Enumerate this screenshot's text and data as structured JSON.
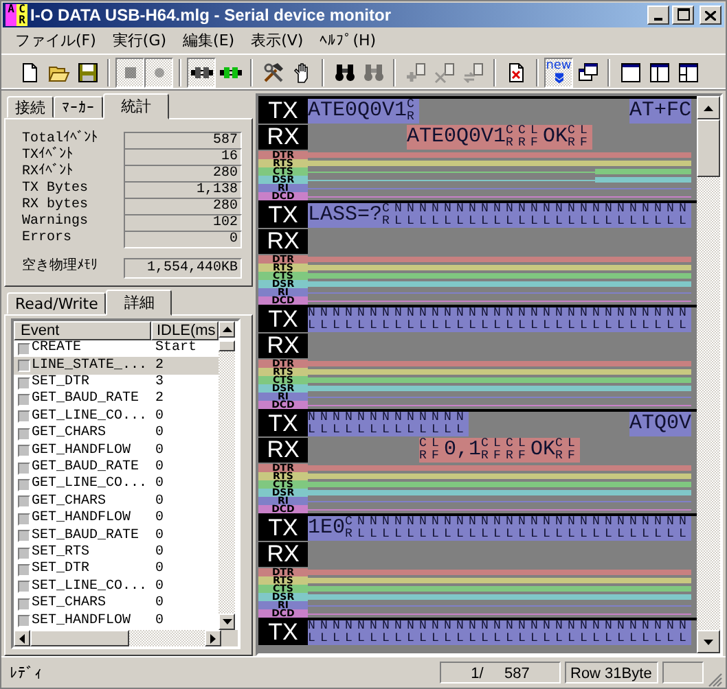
{
  "window": {
    "title": "I-O DATA USB-H64.mlg - Serial device monitor",
    "icon_letters": [
      "A",
      "C",
      "R"
    ]
  },
  "menu": [
    "ファイル(F)",
    "実行(G)",
    "編集(E)",
    "表示(V)",
    "ﾍﾙﾌﾟ(H)"
  ],
  "toolbar": {
    "groups": [
      {
        "buttons": [
          {
            "disabled": false,
            "pressed": false
          },
          {
            "disabled": false,
            "pressed": false
          },
          {
            "disabled": false,
            "pressed": false
          }
        ]
      },
      {
        "buttons": [
          {
            "disabled": true,
            "pressed": true
          },
          {
            "disabled": true,
            "pressed": true
          }
        ]
      },
      {
        "buttons": [
          {
            "disabled": false,
            "pressed": true
          },
          {
            "disabled": false,
            "pressed": false
          }
        ]
      },
      {
        "buttons": [
          {
            "disabled": false,
            "pressed": false
          },
          {
            "disabled": false,
            "pressed": false
          }
        ]
      },
      {
        "buttons": [
          {
            "disabled": false,
            "pressed": false
          },
          {
            "disabled": true,
            "pressed": false
          }
        ]
      },
      {
        "buttons": [
          {
            "disabled": true,
            "pressed": false
          },
          {
            "disabled": true,
            "pressed": false
          },
          {
            "disabled": true,
            "pressed": false
          }
        ]
      },
      {
        "buttons": [
          {
            "disabled": false,
            "pressed": false
          }
        ]
      },
      {
        "buttons": [
          {
            "disabled": false,
            "pressed": true,
            "label": "new"
          },
          {
            "disabled": false,
            "pressed": false
          }
        ]
      },
      {
        "buttons": [
          {
            "disabled": false,
            "pressed": false
          },
          {
            "disabled": false,
            "pressed": false
          },
          {
            "disabled": false,
            "pressed": false
          }
        ]
      }
    ]
  },
  "upper_tabs": [
    {
      "label": "接続",
      "selected": false
    },
    {
      "label": "ﾏｰｶｰ",
      "selected": false
    },
    {
      "label": "統計",
      "selected": true
    }
  ],
  "stats": [
    {
      "label": "Totalｲﾍﾞﾝﾄ",
      "value": "587"
    },
    {
      "label": "TXｲﾍﾞﾝﾄ",
      "value": "16"
    },
    {
      "label": "RXｲﾍﾞﾝﾄ",
      "value": "280"
    },
    {
      "label": "TX Bytes",
      "value": "1,138"
    },
    {
      "label": "RX bytes",
      "value": "280"
    },
    {
      "label": "Warnings",
      "value": "102"
    },
    {
      "label": "Errors",
      "value": "0"
    }
  ],
  "memory": {
    "label": "空き物理ﾒﾓﾘ",
    "value": "1,554,440KB"
  },
  "lower_tabs": [
    {
      "label": "Read/Write",
      "selected": false
    },
    {
      "label": "詳細",
      "selected": true
    }
  ],
  "event_table": {
    "columns": [
      "Event",
      "IDLE(ms"
    ],
    "rows": [
      {
        "event": "CREATE",
        "idle": "Start",
        "selected": false
      },
      {
        "event": "LINE_STATE_...",
        "idle": "2",
        "selected": true
      },
      {
        "event": "SET_DTR",
        "idle": "3",
        "selected": false
      },
      {
        "event": "GET_BAUD_RATE",
        "idle": "2",
        "selected": false
      },
      {
        "event": "GET_LINE_CO...",
        "idle": "0",
        "selected": false
      },
      {
        "event": "GET_CHARS",
        "idle": "0",
        "selected": false
      },
      {
        "event": "GET_HANDFLOW",
        "idle": "0",
        "selected": false
      },
      {
        "event": "GET_BAUD_RATE",
        "idle": "0",
        "selected": false
      },
      {
        "event": "GET_LINE_CO...",
        "idle": "0",
        "selected": false
      },
      {
        "event": "GET_CHARS",
        "idle": "0",
        "selected": false
      },
      {
        "event": "GET_HANDFLOW",
        "idle": "0",
        "selected": false
      },
      {
        "event": "SET_BAUD_RATE",
        "idle": "0",
        "selected": false
      },
      {
        "event": "SET_RTS",
        "idle": "0",
        "selected": false
      },
      {
        "event": "SET_DTR",
        "idle": "0",
        "selected": false
      },
      {
        "event": "SET_LINE_CO...",
        "idle": "0",
        "selected": false
      },
      {
        "event": "SET_CHARS",
        "idle": "0",
        "selected": false
      },
      {
        "event": "SET_HANDFLOW",
        "idle": "0",
        "selected": false
      }
    ]
  },
  "monitor": {
    "blocks": [
      {
        "tx_label": "TX",
        "rx_label": "RX",
        "tx": [
          {
            "kind": "data",
            "tokens": [
              {
                "kind": "text",
                "text": "ATE0Q0V1"
              },
              {
                "kind": "stack",
                "top": "C",
                "bottom": "R"
              }
            ]
          },
          {
            "kind": "idle"
          },
          {
            "kind": "data",
            "tokens": [
              {
                "kind": "text",
                "text": "AT+FC"
              }
            ]
          }
        ],
        "rx": [
          {
            "kind": "idle"
          },
          {
            "kind": "data",
            "tokens": [
              {
                "kind": "text",
                "text": "ATE0Q0V1"
              },
              {
                "kind": "stack",
                "top": "CCL",
                "bottom": "RRF"
              },
              {
                "kind": "text",
                "text": "OK"
              },
              {
                "kind": "stack",
                "top": "CL",
                "bottom": "RF"
              }
            ]
          },
          {
            "kind": "idle"
          }
        ],
        "signals": [
          {
            "name": "DTR",
            "color": "#c88080",
            "segments": [
              {
                "on": true
              }
            ]
          },
          {
            "name": "RTS",
            "color": "#c8c880",
            "segments": [
              {
                "on": true
              }
            ]
          },
          {
            "name": "CTS",
            "color": "#80c880",
            "segments": [
              {
                "on": false
              },
              {
                "on": false
              },
              {
                "on": false
              },
              {
                "on": true
              }
            ]
          },
          {
            "name": "DSR",
            "color": "#80c8c8",
            "segments": [
              {
                "on": false
              },
              {
                "on": false
              },
              {
                "on": false
              },
              {
                "on": true
              }
            ]
          },
          {
            "name": "RI",
            "color": "#8080c8",
            "segments": [
              {
                "on": false
              }
            ]
          },
          {
            "name": "DCD",
            "color": "#c880c8",
            "segments": [
              {
                "on": false
              }
            ]
          }
        ]
      },
      {
        "tx_label": "TX",
        "rx_label": "RX",
        "tx": [
          {
            "kind": "data",
            "tokens": [
              {
                "kind": "text",
                "text": "LASS=?"
              },
              {
                "kind": "stack",
                "top": "CNNNNNNNNNNNNNNNNNNNNNNNN",
                "bottom": "RLLLLLLLLLLLLLLLLLLLLLLLL"
              }
            ]
          }
        ],
        "rx": [
          {
            "kind": "idle"
          }
        ],
        "signals": [
          {
            "name": "DTR",
            "color": "#c88080",
            "segments": [
              {
                "on": true
              }
            ]
          },
          {
            "name": "RTS",
            "color": "#c8c880",
            "segments": [
              {
                "on": true
              }
            ]
          },
          {
            "name": "CTS",
            "color": "#80c880",
            "segments": [
              {
                "on": true
              }
            ]
          },
          {
            "name": "DSR",
            "color": "#80c8c8",
            "segments": [
              {
                "on": true
              }
            ]
          },
          {
            "name": "RI",
            "color": "#8080c8",
            "segments": [
              {
                "on": false
              }
            ]
          },
          {
            "name": "DCD",
            "color": "#c880c8",
            "segments": [
              {
                "on": false
              }
            ]
          }
        ]
      },
      {
        "tx_label": "TX",
        "rx_label": "RX",
        "tx": [
          {
            "kind": "data",
            "tokens": [
              {
                "kind": "stack",
                "top": "NNNNNNNNNNNNNNNNNNNNNNNNNNNNNNN",
                "bottom": "LLLLLLLLLLLLLLLLLLLLLLLLLLLLLLL"
              }
            ]
          }
        ],
        "rx": [
          {
            "kind": "idle"
          }
        ],
        "signals": [
          {
            "name": "DTR",
            "color": "#c88080",
            "segments": [
              {
                "on": true
              }
            ]
          },
          {
            "name": "RTS",
            "color": "#c8c880",
            "segments": [
              {
                "on": true
              }
            ]
          },
          {
            "name": "CTS",
            "color": "#80c880",
            "segments": [
              {
                "on": true
              }
            ]
          },
          {
            "name": "DSR",
            "color": "#80c8c8",
            "segments": [
              {
                "on": true
              }
            ]
          },
          {
            "name": "RI",
            "color": "#8080c8",
            "segments": [
              {
                "on": false
              }
            ]
          },
          {
            "name": "DCD",
            "color": "#c880c8",
            "segments": [
              {
                "on": false
              }
            ]
          }
        ]
      },
      {
        "tx_label": "TX",
        "rx_label": "RX",
        "tx": [
          {
            "kind": "data",
            "tokens": [
              {
                "kind": "stack",
                "top": "NNNNNNNNNNNNN",
                "bottom": "LLLLLLLLLLLLL"
              }
            ]
          },
          {
            "kind": "idle"
          },
          {
            "kind": "data",
            "tokens": [
              {
                "kind": "text",
                "text": "ATQ0V"
              }
            ]
          }
        ],
        "rx": [
          {
            "kind": "idle"
          },
          {
            "kind": "data",
            "tokens": [
              {
                "kind": "stack",
                "top": "CL",
                "bottom": "RF"
              },
              {
                "kind": "text",
                "text": "0,1"
              },
              {
                "kind": "stack",
                "top": "CLCL",
                "bottom": "RFRF"
              },
              {
                "kind": "text",
                "text": "OK"
              },
              {
                "kind": "stack",
                "top": "CL",
                "bottom": "RF"
              }
            ]
          },
          {
            "kind": "idle"
          }
        ],
        "signals": [
          {
            "name": "DTR",
            "color": "#c88080",
            "segments": [
              {
                "on": true
              }
            ]
          },
          {
            "name": "RTS",
            "color": "#c8c880",
            "segments": [
              {
                "on": true
              }
            ]
          },
          {
            "name": "CTS",
            "color": "#80c880",
            "segments": [
              {
                "on": true
              }
            ]
          },
          {
            "name": "DSR",
            "color": "#80c8c8",
            "segments": [
              {
                "on": true
              }
            ]
          },
          {
            "name": "RI",
            "color": "#8080c8",
            "segments": [
              {
                "on": false
              }
            ]
          },
          {
            "name": "DCD",
            "color": "#c880c8",
            "segments": [
              {
                "on": false
              }
            ]
          }
        ]
      },
      {
        "tx_label": "TX",
        "rx_label": "RX",
        "tx": [
          {
            "kind": "data",
            "tokens": [
              {
                "kind": "text",
                "text": "1E0"
              },
              {
                "kind": "stack",
                "top": "CNNNNNNNNNNNNNNNNNNNNNNNNNNN",
                "bottom": "RLLLLLLLLLLLLLLLLLLLLLLLLLLL"
              }
            ]
          }
        ],
        "rx": [
          {
            "kind": "idle"
          }
        ],
        "signals": [
          {
            "name": "DTR",
            "color": "#c88080",
            "segments": [
              {
                "on": true
              }
            ]
          },
          {
            "name": "RTS",
            "color": "#c8c880",
            "segments": [
              {
                "on": true
              }
            ]
          },
          {
            "name": "CTS",
            "color": "#80c880",
            "segments": [
              {
                "on": true
              }
            ]
          },
          {
            "name": "DSR",
            "color": "#80c8c8",
            "segments": [
              {
                "on": true
              }
            ]
          },
          {
            "name": "RI",
            "color": "#8080c8",
            "segments": [
              {
                "on": false
              }
            ]
          },
          {
            "name": "DCD",
            "color": "#c880c8",
            "segments": [
              {
                "on": false
              }
            ]
          }
        ]
      },
      {
        "tx_label": "TX",
        "tx": [
          {
            "kind": "data",
            "tokens": [
              {
                "kind": "stack",
                "top": "NNNNNNNNNNNNNNNNNNNNNNNNNNNNNNN",
                "bottom": "LLLLLLLLLLLLLLLLLLLLLLLLLLLLLLL"
              }
            ]
          }
        ]
      }
    ]
  },
  "status_bar": {
    "message": "ﾚﾃﾞｨ",
    "position": "1/     587",
    "row_info": "Row 31Byte"
  }
}
